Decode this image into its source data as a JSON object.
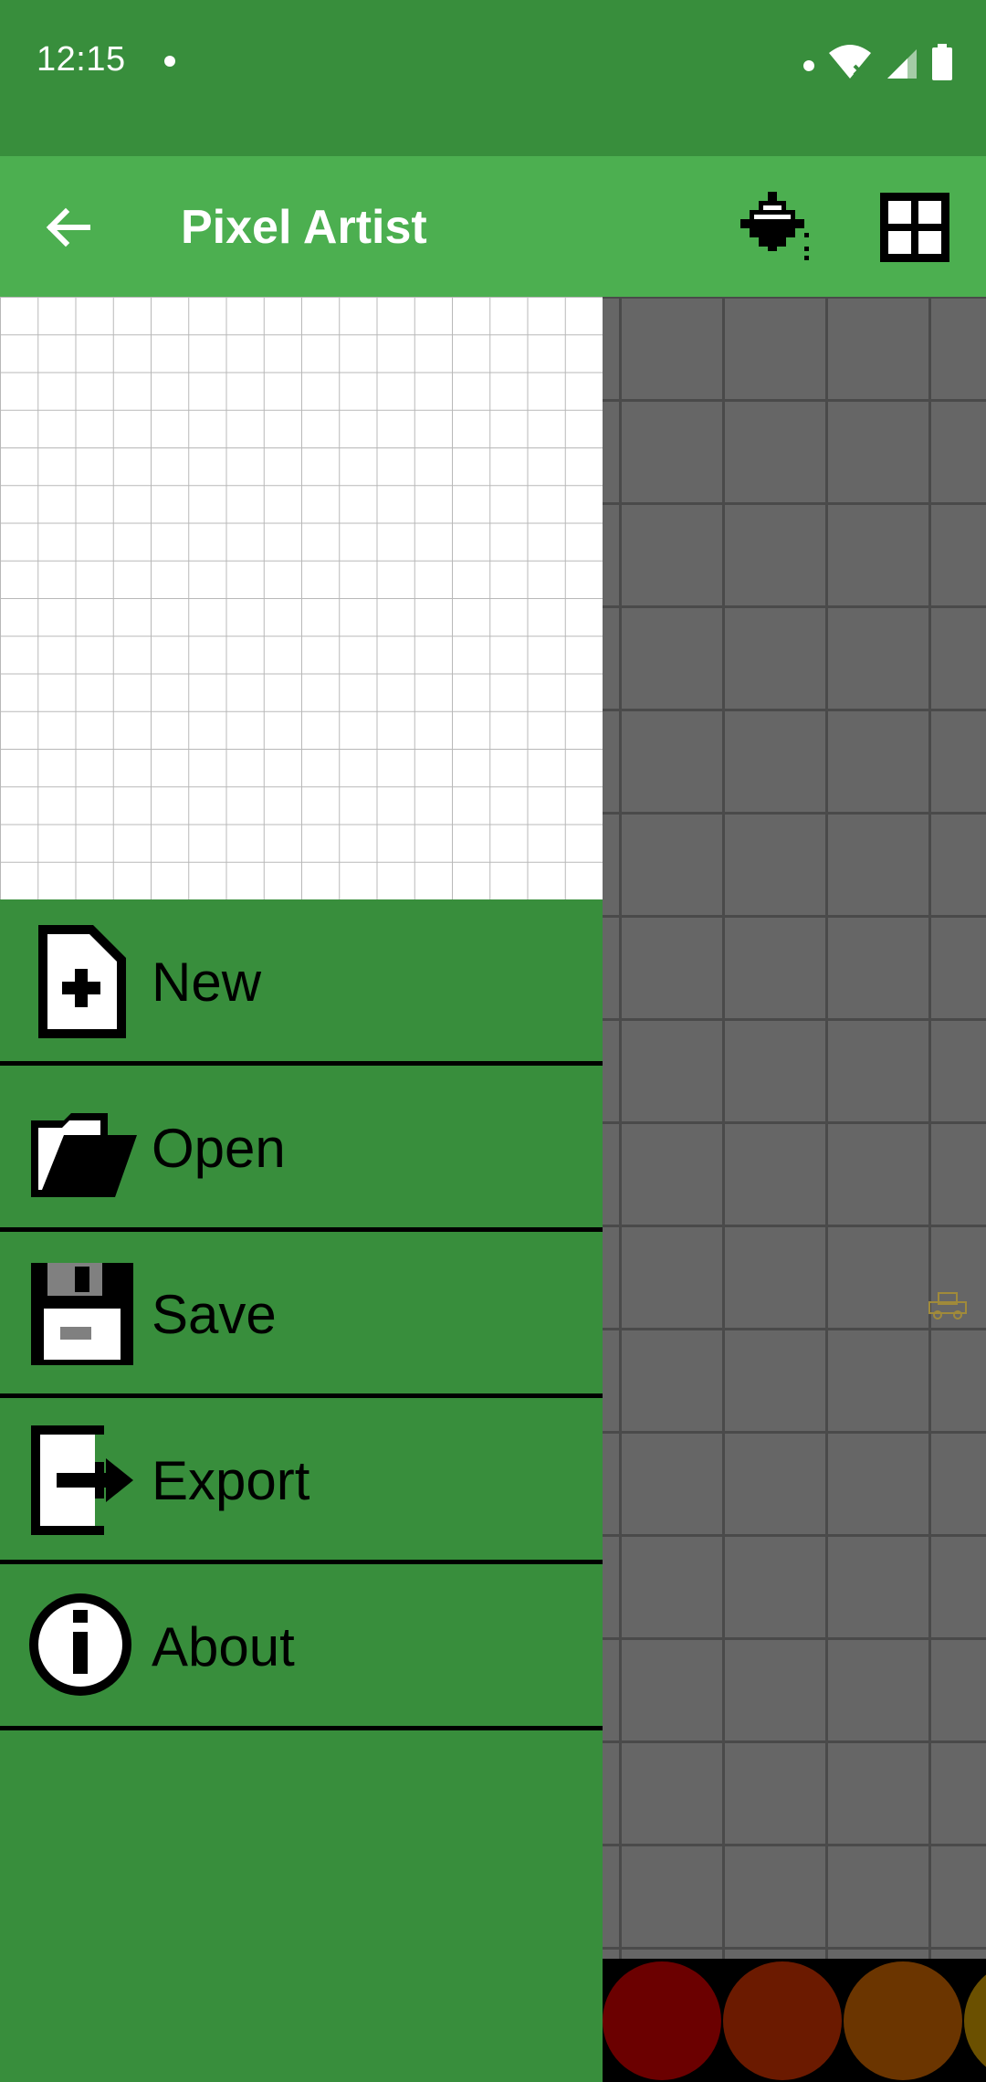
{
  "status_bar": {
    "time": "12:15"
  },
  "app_bar": {
    "title": "Pixel Artist",
    "back_icon": "arrow-left-icon",
    "fill_icon": "paint-bucket-icon",
    "grid_icon": "grid-icon"
  },
  "drawer": {
    "items": [
      {
        "label": "New",
        "icon": "new-file-icon"
      },
      {
        "label": "Open",
        "icon": "folder-open-icon"
      },
      {
        "label": "Save",
        "icon": "floppy-disk-icon"
      },
      {
        "label": "Export",
        "icon": "export-icon"
      },
      {
        "label": "About",
        "icon": "info-icon"
      }
    ]
  },
  "palette": {
    "colors": [
      "#6B0000",
      "#6B1A00",
      "#6B3500",
      "#6B5000"
    ]
  },
  "theme": {
    "status_bar": "#388E3C",
    "app_bar": "#4CAF50",
    "drawer": "#388E3C",
    "canvas": "#666666"
  }
}
